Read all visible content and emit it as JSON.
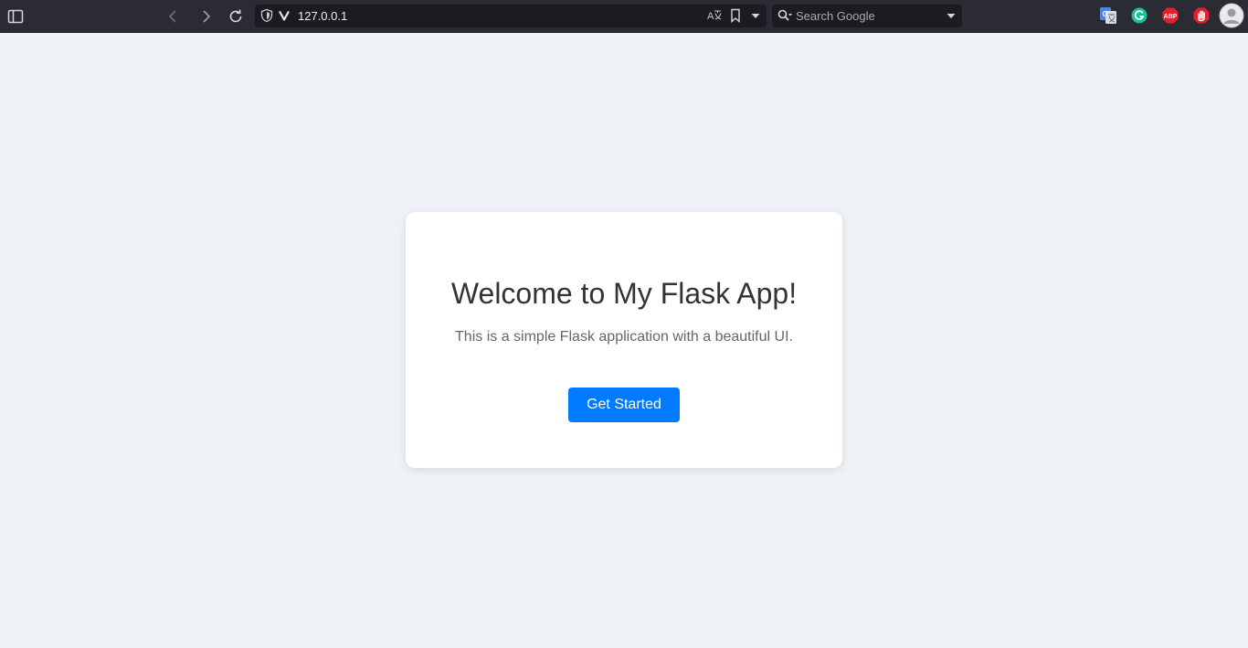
{
  "browser": {
    "address_bar": {
      "url": "127.0.0.1"
    },
    "search_bar": {
      "placeholder": "Search Google"
    },
    "icons": {
      "sidebar_toggle": "sidebar-toggle-icon",
      "back": "chevron-left-icon",
      "forward": "chevron-right-icon",
      "reload": "reload-icon",
      "site_shield": "shield-icon",
      "vivaldi": "vivaldi-icon",
      "translate": "translate-icon",
      "bookmark": "bookmark-icon",
      "dropdown": "dropdown-icon",
      "search": "search-icon",
      "ext_google_translate": "google-translate-icon",
      "ext_grammarly": "grammarly-icon",
      "ext_adblock": "abp-icon",
      "ext_stop": "stop-hand-icon",
      "profile": "avatar-icon"
    },
    "extensions": {
      "adblock_label": "ABP"
    }
  },
  "page": {
    "heading": "Welcome to My Flask App!",
    "description": "This is a simple Flask application with a beautiful UI.",
    "cta_label": "Get Started"
  },
  "colors": {
    "page_background": "#eff2f6",
    "card_background": "#ffffff",
    "accent": "#007bff",
    "heading_text": "#333333",
    "body_text": "#666666",
    "browser_chrome": "#2a2b33"
  }
}
